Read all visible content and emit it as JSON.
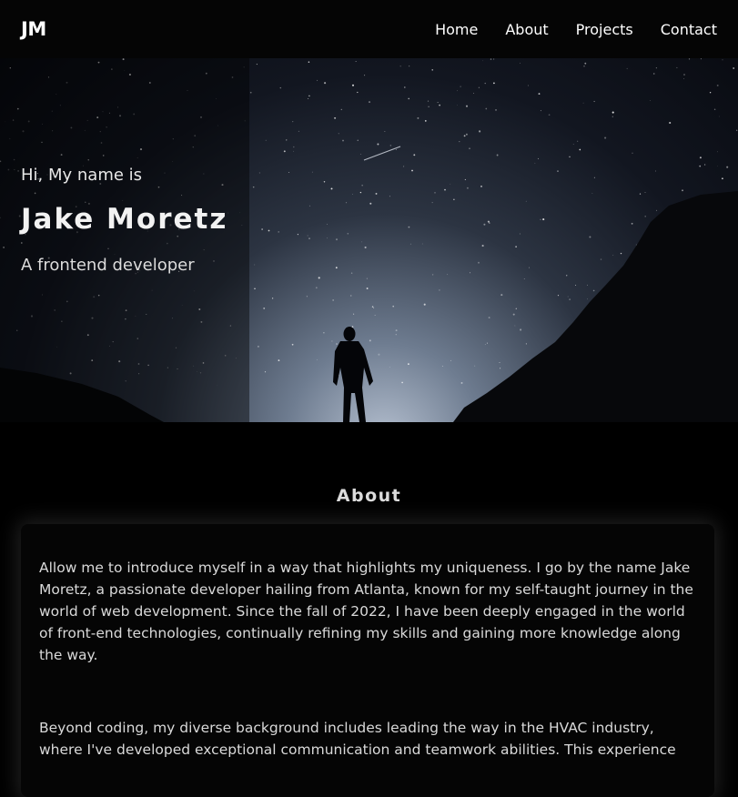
{
  "nav": {
    "logo": "JM",
    "links": [
      "Home",
      "About",
      "Projects",
      "Contact"
    ]
  },
  "hero": {
    "greeting": "Hi, My name is",
    "name": "Jake Moretz",
    "role": "A frontend developer"
  },
  "about": {
    "heading": "About",
    "paragraphs": [
      "Allow me to introduce myself in a way that highlights my uniqueness. I go by the name Jake Moretz, a passionate developer hailing from Atlanta, known for my self-taught journey in the world of web development. Since the fall of 2022, I have been deeply engaged in the world of front-end technologies, continually refining my skills and gaining more knowledge along the way.",
      "Beyond coding, my diverse background includes leading the way in the HVAC industry, where I've developed exceptional communication and teamwork abilities. This experience"
    ]
  },
  "colors": {
    "background": "#000000",
    "navbar": "#050505",
    "text": "#ffffff",
    "card": "#050505"
  }
}
